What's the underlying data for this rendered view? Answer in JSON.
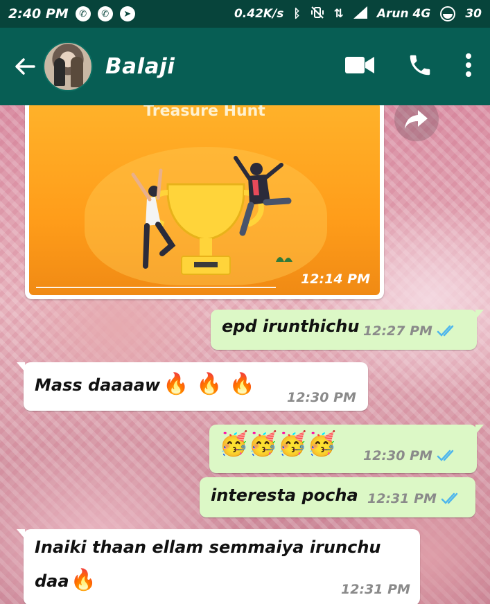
{
  "status_bar": {
    "time": "2:40 PM",
    "net_speed": "0.42K/s",
    "carrier": "Arun 4G",
    "battery": "30",
    "notification_icons": [
      "whatsapp-icon",
      "whatsapp-icon",
      "telegram-icon"
    ],
    "status_icons": [
      "bluetooth-icon",
      "vibrate-icon",
      "data-arrows-icon",
      "signal-icon",
      "battery-icon"
    ]
  },
  "header": {
    "contact_name": "Balaji",
    "actions": [
      "video-call-icon",
      "voice-call-icon",
      "more-options-icon"
    ]
  },
  "messages": [
    {
      "type": "media",
      "direction": "in",
      "title": "Treasure Hunt",
      "time": "12:14 PM"
    },
    {
      "type": "text",
      "direction": "out",
      "text": "epd irunthichu",
      "time": "12:27 PM",
      "ticks": "read"
    },
    {
      "type": "text",
      "direction": "in",
      "text": "Mass daaaaw",
      "emoji": "🔥 🔥 🔥",
      "time": "12:30 PM"
    },
    {
      "type": "emoji",
      "direction": "out",
      "emoji": "🥳🥳🥳🥳",
      "time": "12:30 PM",
      "ticks": "read"
    },
    {
      "type": "text",
      "direction": "out",
      "text": "interesta pocha",
      "time": "12:31 PM",
      "ticks": "read"
    },
    {
      "type": "text",
      "direction": "in",
      "text": "Inaiki thaan ellam semmaiya irunchu",
      "text_line2": "daa",
      "emoji": "🔥",
      "time": "12:31 PM"
    }
  ],
  "colors": {
    "header_bg": "#075e54",
    "status_bg": "#07443b",
    "outgoing_bubble": "#dcf8c6",
    "incoming_bubble": "#ffffff",
    "read_ticks": "#4fb6ec"
  }
}
